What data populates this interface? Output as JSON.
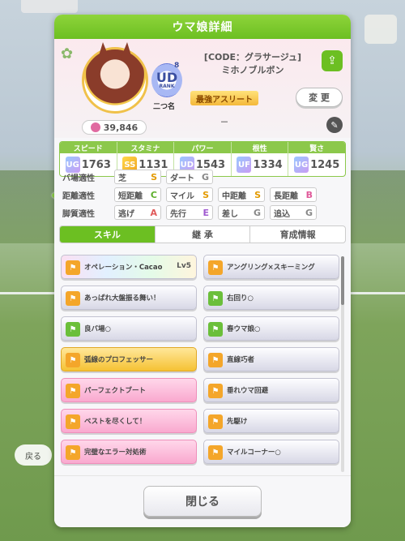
{
  "header": {
    "title": "ウマ娘詳細"
  },
  "background": {
    "side_bubble": "戻る"
  },
  "profile": {
    "code": "[CODE：グラサージュ]",
    "name": "ミホノブルボン",
    "rank_letters": "UD",
    "rank_label": "RANK",
    "rank_num": "8",
    "nickname": "二つ名",
    "fans": "39,846",
    "title_badge": "最強アスリート",
    "change_label": "変 更",
    "dash": "－"
  },
  "stats": [
    {
      "label": "スピード",
      "grade": "UG",
      "value": "1763"
    },
    {
      "label": "スタミナ",
      "grade": "SS",
      "value": "1131"
    },
    {
      "label": "パワー",
      "grade": "UD",
      "value": "1543"
    },
    {
      "label": "根性",
      "grade": "UF",
      "value": "1334"
    },
    {
      "label": "賢さ",
      "grade": "UG",
      "value": "1245"
    }
  ],
  "aptitude": {
    "track": {
      "label": "バ場適性",
      "items": [
        {
          "name": "芝",
          "grade": "S"
        },
        {
          "name": "ダート",
          "grade": "G"
        }
      ]
    },
    "distance": {
      "label": "距離適性",
      "items": [
        {
          "name": "短距離",
          "grade": "C"
        },
        {
          "name": "マイル",
          "grade": "S"
        },
        {
          "name": "中距離",
          "grade": "S"
        },
        {
          "name": "長距離",
          "grade": "B"
        }
      ]
    },
    "style": {
      "label": "脚質適性",
      "items": [
        {
          "name": "逃げ",
          "grade": "A"
        },
        {
          "name": "先行",
          "grade": "E"
        },
        {
          "name": "差し",
          "grade": "G"
        },
        {
          "name": "追込",
          "grade": "G"
        }
      ]
    }
  },
  "tabs": [
    "スキル",
    "継 承",
    "育成情報"
  ],
  "skills": [
    {
      "name": "オペレーション・Cacao",
      "level": "Lv5",
      "style": "rainbow"
    },
    {
      "name": "アングリング×スキーミング",
      "level": "",
      "style": "white"
    },
    {
      "name": "あっぱれ大盤振る舞い！",
      "level": "",
      "style": "white"
    },
    {
      "name": "右回り○",
      "level": "",
      "style": "white"
    },
    {
      "name": "良バ場○",
      "level": "",
      "style": "white"
    },
    {
      "name": "春ウマ娘○",
      "level": "",
      "style": "white"
    },
    {
      "name": "弧線のプロフェッサー",
      "level": "",
      "style": "gold"
    },
    {
      "name": "直線巧者",
      "level": "",
      "style": "white"
    },
    {
      "name": "パーフェクトブート",
      "level": "",
      "style": "pink"
    },
    {
      "name": "垂れウマ回避",
      "level": "",
      "style": "white"
    },
    {
      "name": "ベストを尽くして！",
      "level": "",
      "style": "pink"
    },
    {
      "name": "先駆け",
      "level": "",
      "style": "white"
    },
    {
      "name": "完璧なエラー対処術",
      "level": "",
      "style": "pink"
    },
    {
      "name": "マイルコーナー○",
      "level": "",
      "style": "white"
    }
  ],
  "footer": {
    "close_label": "閉じる"
  }
}
